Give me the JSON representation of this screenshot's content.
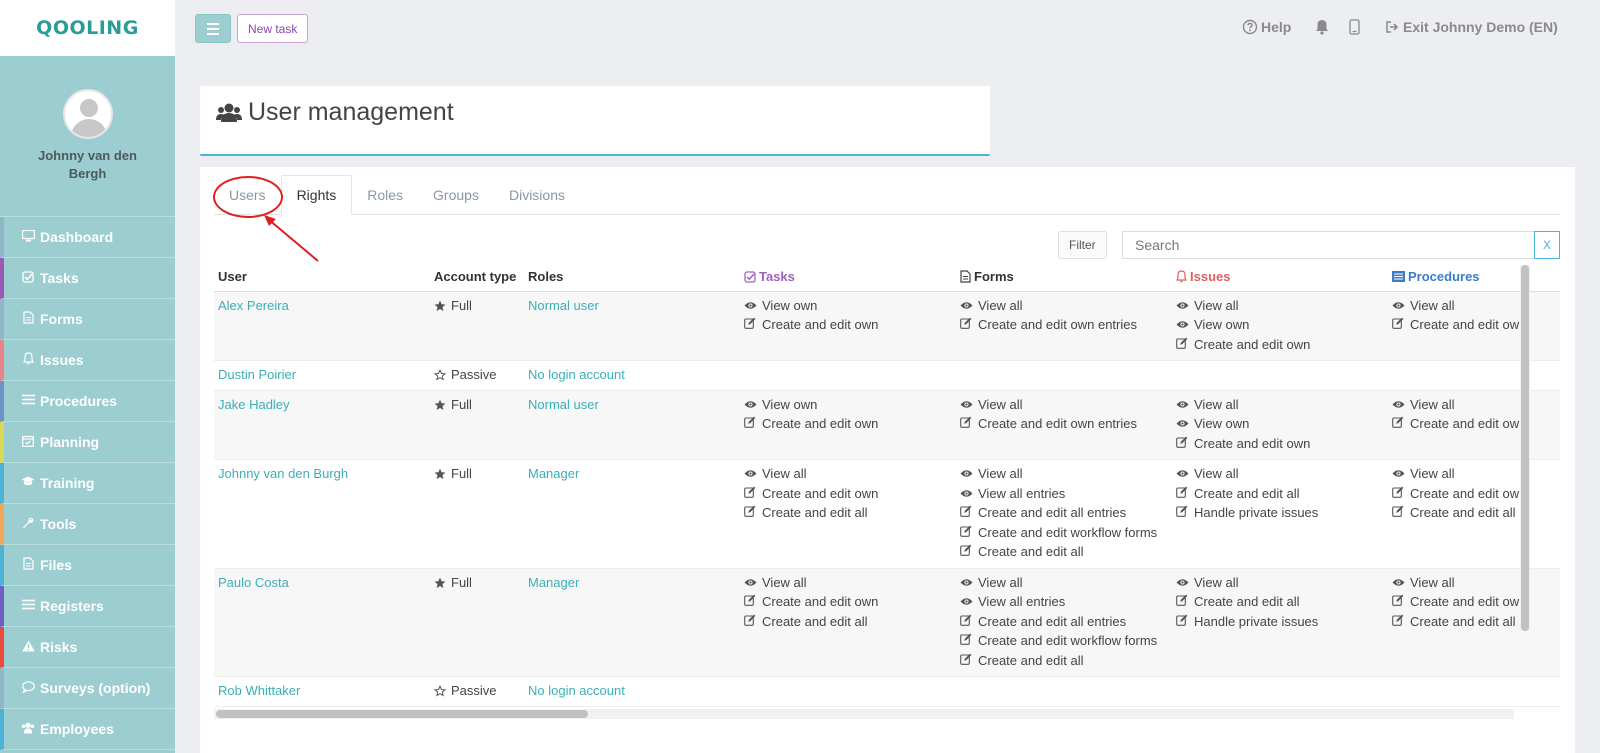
{
  "app": {
    "logo": "QOOLING"
  },
  "profile": {
    "name": "Johnny van den Bergh"
  },
  "sidebar": {
    "items": [
      {
        "label": "Dashboard",
        "icon": "monitor-icon",
        "accent": "#8fb7c8"
      },
      {
        "label": "Tasks",
        "icon": "check-square-icon",
        "accent": "#9b59b6"
      },
      {
        "label": "Forms",
        "icon": "file-icon",
        "accent": "#8fb7c8"
      },
      {
        "label": "Issues",
        "icon": "bell-icon",
        "accent": "#e8828b"
      },
      {
        "label": "Procedures",
        "icon": "list-icon",
        "accent": "#6f93c9"
      },
      {
        "label": "Planning",
        "icon": "calendar-icon",
        "accent": "#d9d95a"
      },
      {
        "label": "Training",
        "icon": "graduation-cap-icon",
        "accent": "#4db3d6"
      },
      {
        "label": "Tools",
        "icon": "wrench-icon",
        "accent": "#f0a75a"
      },
      {
        "label": "Files",
        "icon": "file-icon",
        "accent": "#4db3d6"
      },
      {
        "label": "Registers",
        "icon": "list-icon",
        "accent": "#6f5fc4"
      },
      {
        "label": "Risks",
        "icon": "warning-icon",
        "accent": "#e84c3d"
      },
      {
        "label": "Surveys (option)",
        "icon": "comment-icon",
        "accent": "#8fb7c8"
      },
      {
        "label": "Employees",
        "icon": "users-icon",
        "accent": "#4db3d6"
      }
    ]
  },
  "topbar": {
    "new_task": "New task",
    "help": "Help",
    "exit": "Exit Johnny Demo (EN)"
  },
  "header": {
    "title": "User management"
  },
  "tabs": [
    {
      "label": "Users",
      "active": false
    },
    {
      "label": "Rights",
      "active": true
    },
    {
      "label": "Roles",
      "active": false
    },
    {
      "label": "Groups",
      "active": false
    },
    {
      "label": "Divisions",
      "active": false
    }
  ],
  "toolbar": {
    "filter_label": "Filter",
    "search_placeholder": "Search",
    "clear_label": "X"
  },
  "table": {
    "columns": {
      "user": "User",
      "account_type": "Account type",
      "roles": "Roles",
      "tasks": "Tasks",
      "forms": "Forms",
      "issues": "Issues",
      "procedures": "Procedures"
    },
    "rows": [
      {
        "user": "Alex Pereira",
        "account_type": "Full",
        "role": "Normal user",
        "tasks": [
          {
            "icon": "eye-icon",
            "text": "View own"
          },
          {
            "icon": "edit-icon",
            "text": "Create and edit own"
          }
        ],
        "forms": [
          {
            "icon": "eye-icon",
            "text": "View all"
          },
          {
            "icon": "edit-icon",
            "text": "Create and edit own entries"
          }
        ],
        "issues": [
          {
            "icon": "eye-icon",
            "text": "View all"
          },
          {
            "icon": "eye-icon",
            "text": "View own"
          },
          {
            "icon": "edit-icon",
            "text": "Create and edit own"
          }
        ],
        "procedures": [
          {
            "icon": "eye-icon",
            "text": "View all"
          },
          {
            "icon": "edit-icon",
            "text": "Create and edit own"
          }
        ]
      },
      {
        "user": "Dustin Poirier",
        "account_type": "Passive",
        "role": "No login account",
        "tasks": [],
        "forms": [],
        "issues": [],
        "procedures": []
      },
      {
        "user": "Jake Hadley",
        "account_type": "Full",
        "role": "Normal user",
        "tasks": [
          {
            "icon": "eye-icon",
            "text": "View own"
          },
          {
            "icon": "edit-icon",
            "text": "Create and edit own"
          }
        ],
        "forms": [
          {
            "icon": "eye-icon",
            "text": "View all"
          },
          {
            "icon": "edit-icon",
            "text": "Create and edit own entries"
          }
        ],
        "issues": [
          {
            "icon": "eye-icon",
            "text": "View all"
          },
          {
            "icon": "eye-icon",
            "text": "View own"
          },
          {
            "icon": "edit-icon",
            "text": "Create and edit own"
          }
        ],
        "procedures": [
          {
            "icon": "eye-icon",
            "text": "View all"
          },
          {
            "icon": "edit-icon",
            "text": "Create and edit own"
          }
        ]
      },
      {
        "user": "Johnny van den Burgh",
        "account_type": "Full",
        "role": "Manager",
        "tasks": [
          {
            "icon": "eye-icon",
            "text": "View all"
          },
          {
            "icon": "edit-icon",
            "text": "Create and edit own"
          },
          {
            "icon": "edit-icon",
            "text": "Create and edit all"
          }
        ],
        "forms": [
          {
            "icon": "eye-icon",
            "text": "View all"
          },
          {
            "icon": "eye-icon",
            "text": "View all entries"
          },
          {
            "icon": "edit-icon",
            "text": "Create and edit all entries"
          },
          {
            "icon": "edit-icon",
            "text": "Create and edit workflow forms"
          },
          {
            "icon": "edit-icon",
            "text": "Create and edit all"
          }
        ],
        "issues": [
          {
            "icon": "eye-icon",
            "text": "View all"
          },
          {
            "icon": "edit-icon",
            "text": "Create and edit all"
          },
          {
            "icon": "edit-icon",
            "text": "Handle private issues"
          }
        ],
        "procedures": [
          {
            "icon": "eye-icon",
            "text": "View all"
          },
          {
            "icon": "edit-icon",
            "text": "Create and edit own"
          },
          {
            "icon": "edit-icon",
            "text": "Create and edit all"
          }
        ]
      },
      {
        "user": "Paulo Costa",
        "account_type": "Full",
        "role": "Manager",
        "tasks": [
          {
            "icon": "eye-icon",
            "text": "View all"
          },
          {
            "icon": "edit-icon",
            "text": "Create and edit own"
          },
          {
            "icon": "edit-icon",
            "text": "Create and edit all"
          }
        ],
        "forms": [
          {
            "icon": "eye-icon",
            "text": "View all"
          },
          {
            "icon": "eye-icon",
            "text": "View all entries"
          },
          {
            "icon": "edit-icon",
            "text": "Create and edit all entries"
          },
          {
            "icon": "edit-icon",
            "text": "Create and edit workflow forms"
          },
          {
            "icon": "edit-icon",
            "text": "Create and edit all"
          }
        ],
        "issues": [
          {
            "icon": "eye-icon",
            "text": "View all"
          },
          {
            "icon": "edit-icon",
            "text": "Create and edit all"
          },
          {
            "icon": "edit-icon",
            "text": "Handle private issues"
          }
        ],
        "procedures": [
          {
            "icon": "eye-icon",
            "text": "View all"
          },
          {
            "icon": "edit-icon",
            "text": "Create and edit own"
          },
          {
            "icon": "edit-icon",
            "text": "Create and edit all"
          }
        ]
      },
      {
        "user": "Rob Whittaker",
        "account_type": "Passive",
        "role": "No login account",
        "tasks": [],
        "forms": [],
        "issues": [],
        "procedures": []
      }
    ]
  }
}
